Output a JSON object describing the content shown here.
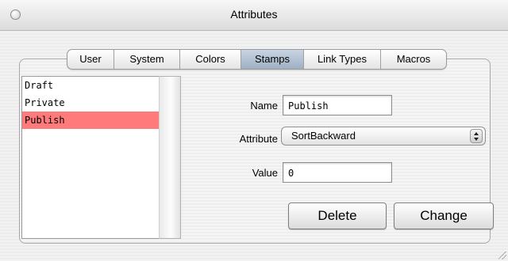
{
  "window": {
    "title": "Attributes"
  },
  "tabs": [
    {
      "label": "User"
    },
    {
      "label": "System"
    },
    {
      "label": "Colors"
    },
    {
      "label": "Stamps",
      "active": true
    },
    {
      "label": "Link Types"
    },
    {
      "label": "Macros"
    }
  ],
  "stamps_list": {
    "items": [
      "Draft",
      "Private",
      "Publish"
    ],
    "selected": "Publish"
  },
  "form": {
    "name_label": "Name",
    "name_value": "Publish",
    "attribute_label": "Attribute",
    "attribute_value": "SortBackward",
    "value_label": "Value",
    "value_value": "0"
  },
  "buttons": {
    "delete_label": "Delete",
    "change_label": "Change"
  },
  "colors": {
    "selection": "#ff7b7b",
    "active_tab": "#aebdd0"
  }
}
